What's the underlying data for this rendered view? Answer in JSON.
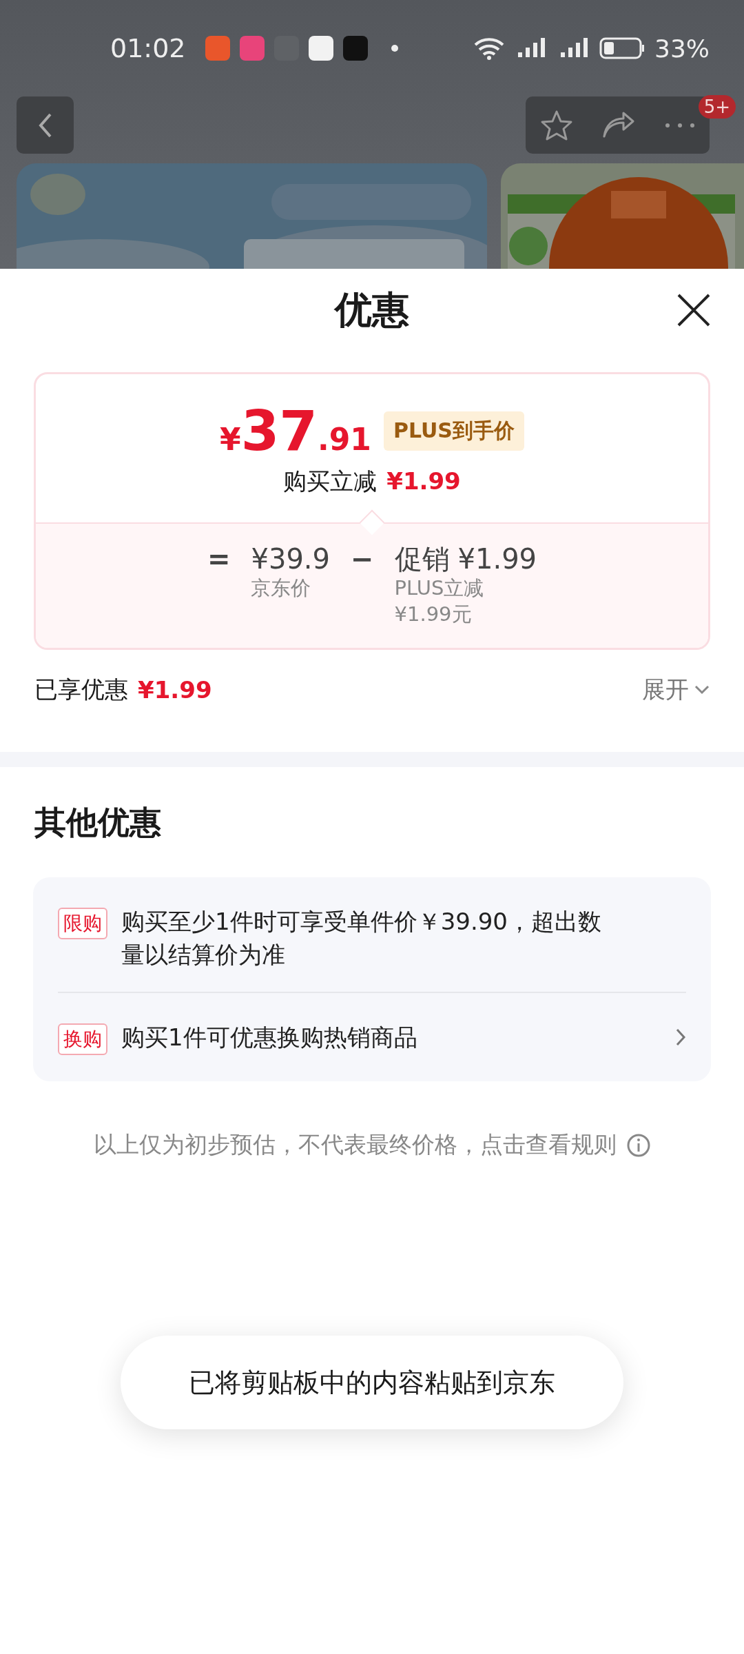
{
  "status_bar": {
    "time": "01:02",
    "battery": "33%"
  },
  "nav": {
    "badge": "5+"
  },
  "sheet": {
    "title": "优惠",
    "price_card": {
      "currency": "¥",
      "price_main": "37",
      "price_decimal": ".91",
      "tag": "PLUS到手价",
      "reduction_label": "购买立减",
      "reduction_value": "¥1.99",
      "breakdown": {
        "equals": "=",
        "base_price": "¥39.9",
        "base_label": "京东价",
        "minus": "−",
        "promo_label": "促销",
        "promo_value": "¥1.99",
        "promo_detail": [
          "PLUS立减",
          "¥1.99元"
        ]
      }
    },
    "enjoyed": {
      "label": "已享优惠",
      "value": "¥1.99"
    },
    "expand": "展开"
  },
  "other": {
    "title": "其他优惠",
    "items": [
      {
        "kind": "info",
        "tag": "限购",
        "text": "购买至少1件时可享受单件价￥39.90，超出数量以结算价为准"
      },
      {
        "kind": "link",
        "tag": "换购",
        "text": "购买1件可优惠换购热销商品"
      }
    ]
  },
  "note": "以上仅为初步预估，不代表最终价格，点击查看规则",
  "toast": "已将剪贴板中的内容粘贴到京东"
}
